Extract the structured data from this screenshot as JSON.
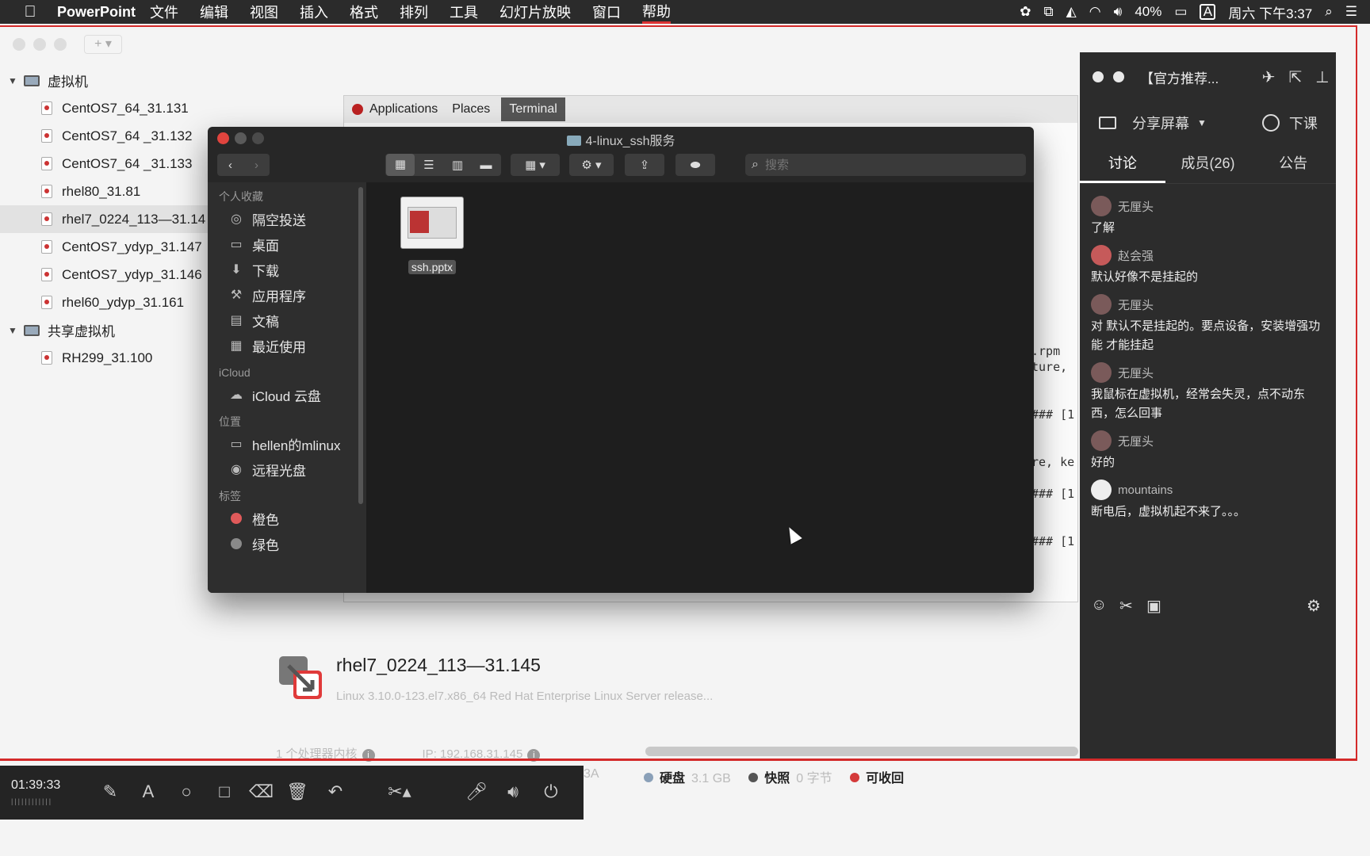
{
  "menubar": {
    "app_name": "PowerPoint",
    "items": [
      "文件",
      "编辑",
      "视图",
      "插入",
      "格式",
      "排列",
      "工具",
      "幻灯片放映",
      "窗口",
      "帮助"
    ],
    "active_item_index": 9,
    "input_method": "A",
    "battery": "40%",
    "clock": "周六 下午3:37"
  },
  "library": {
    "groups": [
      {
        "label": "虚拟机",
        "items": [
          {
            "label": "CentOS7_64_31.131"
          },
          {
            "label": "CentOS7_64 _31.132"
          },
          {
            "label": "CentOS7_64 _31.133"
          },
          {
            "label": "rhel80_31.81"
          },
          {
            "label": "rhel7_0224_113—31.14"
          },
          {
            "label": "CentOS7_ydyp_31.147"
          },
          {
            "label": "CentOS7_ydyp_31.146"
          },
          {
            "label": "rhel60_ydyp_31.161"
          }
        ],
        "selected_index": 4
      },
      {
        "label": "共享虚拟机",
        "items": [
          {
            "label": "RH299_31.100"
          }
        ]
      }
    ]
  },
  "vm_screen": {
    "gnome_menus": [
      "Applications",
      "Places",
      "Terminal"
    ],
    "terminal_lines": [
      ".rpm",
      "ture,",
      "",
      "",
      "### [1",
      "",
      "",
      "re, ke",
      "",
      "### [1",
      "",
      "",
      "### [1"
    ]
  },
  "finder": {
    "title": "4-linux_ssh服务",
    "search_placeholder": "搜索",
    "sidebar": {
      "favorites_header": "个人收藏",
      "favorites": [
        {
          "label": "隔空投送",
          "icon": "airdrop-icon",
          "glyph": "◎"
        },
        {
          "label": "桌面",
          "icon": "desktop-icon",
          "glyph": "▭"
        },
        {
          "label": "下载",
          "icon": "download-icon",
          "glyph": "⬇"
        },
        {
          "label": "应用程序",
          "icon": "applications-icon",
          "glyph": "⚒"
        },
        {
          "label": "文稿",
          "icon": "documents-icon",
          "glyph": "▤"
        },
        {
          "label": "最近使用",
          "icon": "recents-icon",
          "glyph": "▦"
        }
      ],
      "icloud_header": "iCloud",
      "icloud": [
        {
          "label": "iCloud 云盘",
          "icon": "cloud-icon",
          "glyph": "☁"
        }
      ],
      "locations_header": "位置",
      "locations": [
        {
          "label": "hellen的mlinux",
          "icon": "laptop-icon",
          "glyph": "▭"
        },
        {
          "label": "远程光盘",
          "icon": "disc-icon",
          "glyph": "◉"
        }
      ],
      "tags_header": "标签",
      "tags": [
        {
          "label": "橙色",
          "color": "#e05a5a"
        },
        {
          "label": "绿色",
          "color": "#8a8a8a"
        }
      ]
    },
    "files": [
      {
        "name": "ssh.pptx"
      }
    ]
  },
  "vm_detail": {
    "name": "rhel7_0224_113—31.145",
    "description": "Linux 3.10.0-123.el7.x86_64 Red Hat Enterprise Linux Server release...",
    "cpu": "1 个处理器内核",
    "ip": "IP: 192.168.31.145",
    "disk_label": "硬盘",
    "disk_value": "3.1 GB",
    "snapshot_label": "快照",
    "snapshot_value": "0 字节",
    "reclaim_label": "可收回",
    "hidden_fragment": "3A"
  },
  "recorder": {
    "time": "01:39:33"
  },
  "chat": {
    "title": "【官方推荐...",
    "share_label": "分享屏幕",
    "end_label": "下课",
    "tabs": [
      "讨论",
      "成员(26)",
      "公告"
    ],
    "active_tab": 0,
    "messages": [
      {
        "user": "无厘头",
        "text": "了解"
      },
      {
        "user": "赵会强",
        "text": "默认好像不是挂起的"
      },
      {
        "user": "无厘头",
        "text": "对 默认不是挂起的。要点设备，安装增强功能 才能挂起"
      },
      {
        "user": "无厘头",
        "text": "我鼠标在虚拟机，经常会失灵，点不动东西，怎么回事"
      },
      {
        "user": "无厘头",
        "text": "好的"
      },
      {
        "user": "mountains",
        "text": "断电后，虚拟机起不来了。。。"
      }
    ]
  },
  "colors": {
    "record_frame": "#d42a2a",
    "finder_bg": "#1e1e1e",
    "chat_bg": "#2c2c2c"
  }
}
